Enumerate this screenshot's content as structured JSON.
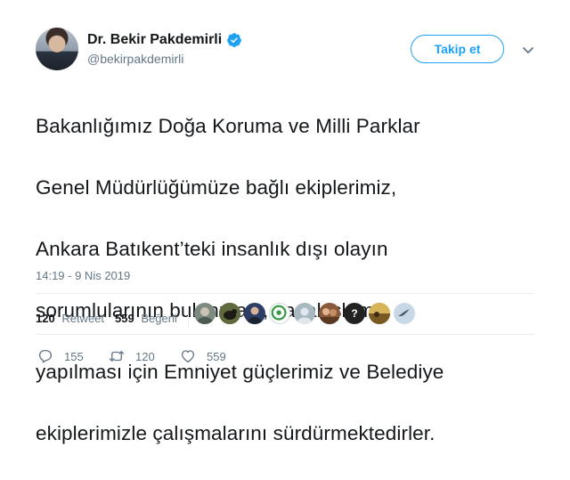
{
  "author": {
    "display_name": "Dr. Bekir Pakdemirli",
    "handle": "@bekirpakdemirli",
    "verified": true
  },
  "follow_label": "Takip et",
  "tweet": {
    "text_lines": [
      "Bakanlığımız Doğa Koruma ve Milli Parklar",
      "Genel Müdürlüğümüze bağlı ekiplerimiz,",
      "Ankara Batıkent’teki insanlık dışı olayın",
      "sorumlularının bulunması, yasal işlem",
      "yapılması için Emniyet güçlerimiz ve Belediye",
      "ekiplerimizle çalışmalarını sürdürmektedirler."
    ],
    "timestamp": "14:19 - 9 Nis 2019"
  },
  "stats": {
    "retweet_count": "120",
    "retweet_label": "Retweet",
    "like_count": "559",
    "like_label": "Beğeni"
  },
  "likers": [
    {
      "icon": "person-photo-icon",
      "color": "#7d8a80"
    },
    {
      "icon": "animal-photo-icon",
      "color": "#3f4a2e"
    },
    {
      "icon": "person-suit-icon",
      "color": "#2c3e66"
    },
    {
      "icon": "emblem-green-icon",
      "color": "#3c9a4a"
    },
    {
      "icon": "default-profile-icon",
      "color": "#aab8c2"
    },
    {
      "icon": "people-photo-icon",
      "color": "#8a5a3a"
    },
    {
      "icon": "question-mark-icon",
      "color": "#222222",
      "glyph": "?"
    },
    {
      "icon": "outdoor-photo-icon",
      "color": "#b5892e"
    },
    {
      "icon": "bird-icon",
      "color": "#c9d8e6"
    }
  ],
  "actions": {
    "reply_count": "155",
    "retweet_count": "120",
    "like_count": "559"
  },
  "colors": {
    "accent": "#1da1f2",
    "text": "#14171a",
    "secondary": "#657786",
    "divider": "#e6ecf0"
  }
}
